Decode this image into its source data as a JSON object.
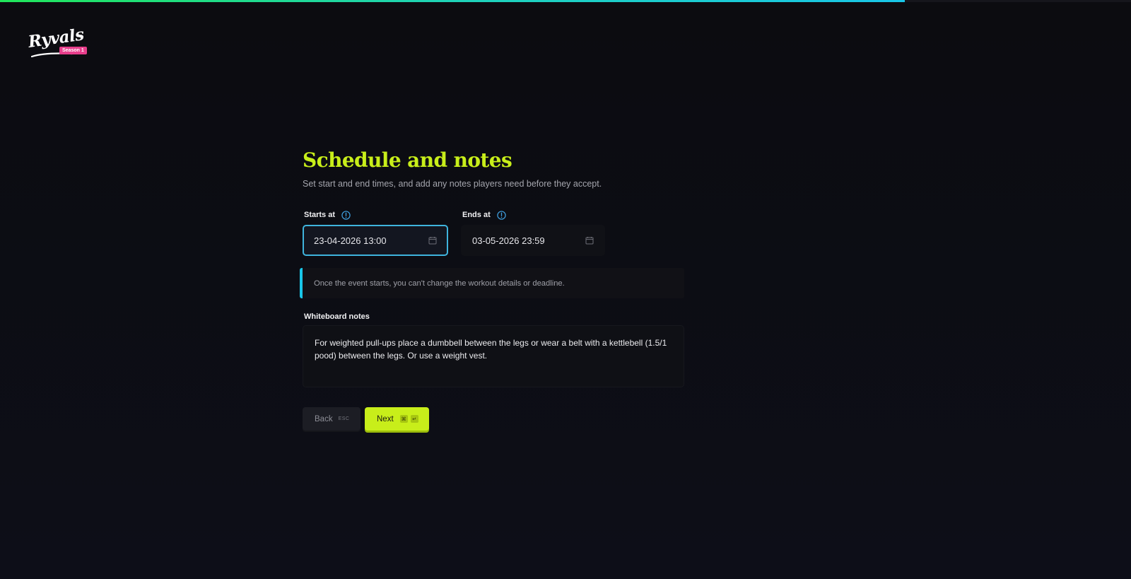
{
  "progress": {
    "fraction": 0.8
  },
  "logo": {
    "wordmark": "Ryvals",
    "badge": "Season 1"
  },
  "page": {
    "title": "Schedule and notes",
    "subtitle": "Set start and end times, and add any notes players need before they accept."
  },
  "starts_at": {
    "label": "Starts at",
    "value": "23-04-2026 13:00"
  },
  "ends_at": {
    "label": "Ends at",
    "value": "03-05-2026 23:59"
  },
  "notice": {
    "text": "Once the event starts, you can't change the workout details or deadline."
  },
  "notes": {
    "label": "Whiteboard notes",
    "value": "For weighted pull-ups place a dumbbell between the legs or wear a belt with a kettlebell (1.5/1 pood) between the legs. Or use a weight vest."
  },
  "buttons": {
    "back_label": "Back",
    "back_shortcut": "ESC",
    "next_label": "Next",
    "next_shortcut_mod": "⌘",
    "next_shortcut_key": "↵"
  },
  "colors": {
    "accent": "#c8ee1a",
    "focus": "#3fb4dd",
    "notice_bar": "#19c6e8",
    "badge": "#e83e8c"
  },
  "icons": {
    "info": "info-icon",
    "calendar": "calendar-icon"
  }
}
